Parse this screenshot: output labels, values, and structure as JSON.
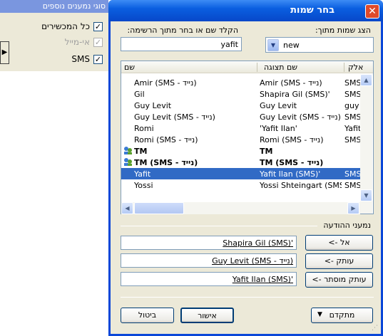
{
  "left_panel": {
    "header": "סוגי נמענים נוספים",
    "options": [
      {
        "label": "כל המכשירים",
        "checked": true,
        "disabled": false
      },
      {
        "label": "אי-מייל",
        "checked": true,
        "disabled": true
      },
      {
        "label": "SMS",
        "checked": true,
        "disabled": false
      }
    ]
  },
  "dialog": {
    "title": "בחר שמות",
    "show_from_label": "הצג שמות מתוך:",
    "show_from_value": "new",
    "search_label": "הקלד שם או בחר מתוך הרשימה:",
    "search_value": "yafit",
    "list": {
      "columns": [
        "שם",
        "שם תצוגה",
        "אלק"
      ],
      "rows": [
        {
          "name": "Amir (SMS - נייד)",
          "display": "Amir (SMS - נייד)",
          "email": "SMS",
          "bold": false,
          "selected": false,
          "icon": false
        },
        {
          "name": "Gil",
          "display": "Shapira Gil (SMS)'",
          "email": "SMS",
          "bold": false,
          "selected": false,
          "icon": false
        },
        {
          "name": "Guy Levit",
          "display": "Guy Levit",
          "email": "guy",
          "bold": false,
          "selected": false,
          "icon": false
        },
        {
          "name": "Guy Levit (SMS - נייד)",
          "display": "Guy Levit (SMS - נייד)",
          "email": "SMS",
          "bold": false,
          "selected": false,
          "icon": false
        },
        {
          "name": "Romi",
          "display": "'Yafit Ilan'",
          "email": "Yafit",
          "bold": false,
          "selected": false,
          "icon": false
        },
        {
          "name": "Romi (SMS - נייד)",
          "display": "Romi (SMS - נייד)",
          "email": "SMS",
          "bold": false,
          "selected": false,
          "icon": false
        },
        {
          "name": "TM",
          "display": "TM",
          "email": "",
          "bold": true,
          "selected": false,
          "icon": true
        },
        {
          "name": "TM (SMS - נייד)",
          "display": "TM (SMS - נייד)",
          "email": "",
          "bold": true,
          "selected": false,
          "icon": true
        },
        {
          "name": "Yafit",
          "display": "Yafit Ilan (SMS)'",
          "email": "SMS",
          "bold": false,
          "selected": true,
          "icon": false
        },
        {
          "name": "Yossi",
          "display": "Yossi Shteingart (SMS)'",
          "email": "SMS",
          "bold": false,
          "selected": false,
          "icon": false
        }
      ]
    },
    "recipients_label": "נמעני ההודעה",
    "recipients": [
      {
        "button": "אל ->",
        "value": "Shapira Gil (SMS)'"
      },
      {
        "button": "עותק ->",
        "value": "Guy Levit (SMS - נייד)"
      },
      {
        "button": "עותק מוסתר ->",
        "value": "Yafit Ilan (SMS)'"
      }
    ],
    "advanced_label": "מתקדם",
    "ok_label": "אישור",
    "cancel_label": "ביטול"
  }
}
